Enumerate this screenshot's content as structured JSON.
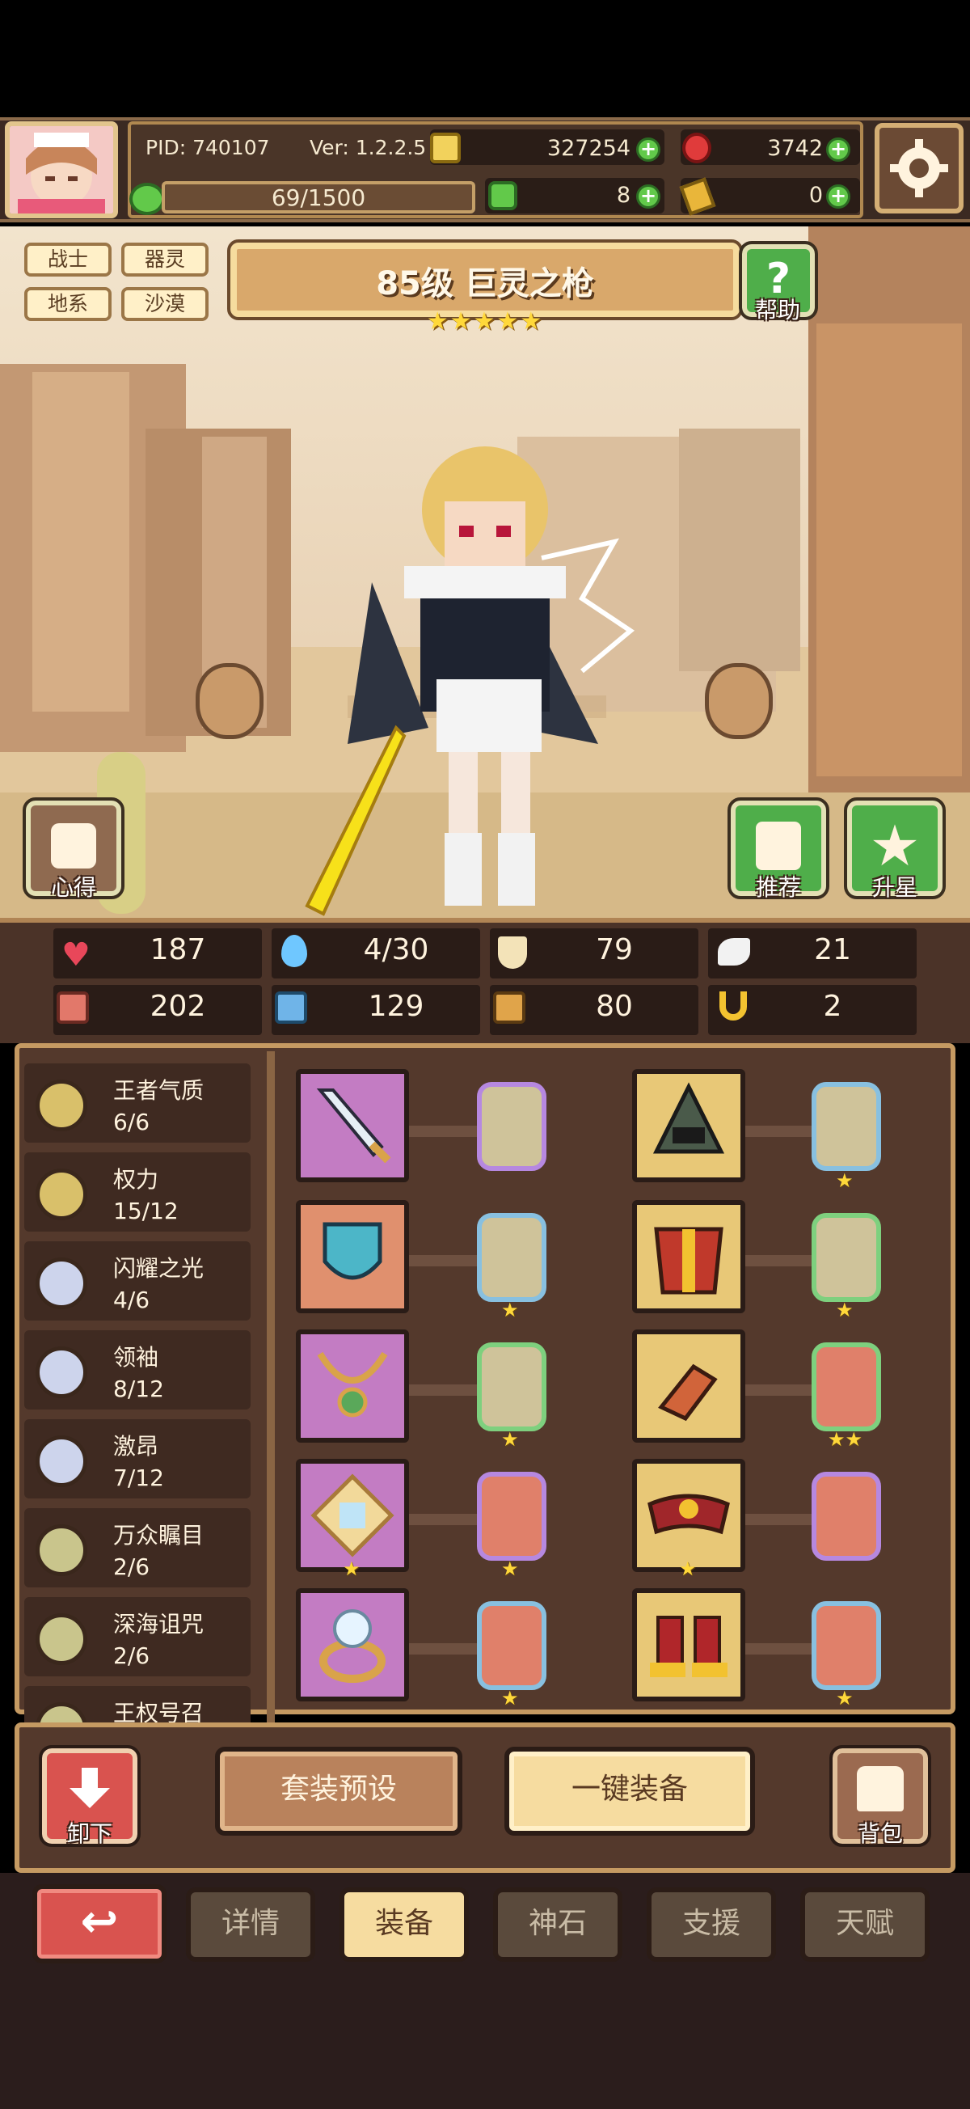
{
  "header": {
    "pid": "PID: 740107",
    "version": "Ver: 1.2.2.5",
    "gold": "327254",
    "gems": "3742",
    "clover": "8",
    "key": "0",
    "xp": "69/1500"
  },
  "hero": {
    "tags": [
      "战士",
      "器灵",
      "地系",
      "沙漠"
    ],
    "title": "85级 巨灵之枪",
    "stars": "★★★★★",
    "help_label": "帮助",
    "notes_label": "心得",
    "recommend_label": "推荐",
    "starup_label": "升星"
  },
  "stats": {
    "hp": "187",
    "mana": "4/30",
    "defense": "79",
    "speed": "21",
    "attack": "202",
    "magic": "129",
    "resist": "80",
    "crit": "2"
  },
  "sets": [
    {
      "name": "王者气质",
      "progress": "6/6"
    },
    {
      "name": "权力",
      "progress": "15/12"
    },
    {
      "name": "闪耀之光",
      "progress": "4/6"
    },
    {
      "name": "领袖",
      "progress": "8/12"
    },
    {
      "name": "激昂",
      "progress": "7/12"
    },
    {
      "name": "万众瞩目",
      "progress": "2/6"
    },
    {
      "name": "深海诅咒",
      "progress": "2/6"
    },
    {
      "name": "王权号召",
      "progress": ""
    }
  ],
  "actions": {
    "unequip": "卸下",
    "preset": "套装预设",
    "auto_equip": "一键装备",
    "bag": "背包"
  },
  "tabs": [
    "详情",
    "装备",
    "神石",
    "支援",
    "天赋"
  ],
  "colors": {
    "gold_border": "#c59a62",
    "active_tab": "#f6dca0",
    "back_button": "#d9534f",
    "green_button": "#4fae4a"
  }
}
